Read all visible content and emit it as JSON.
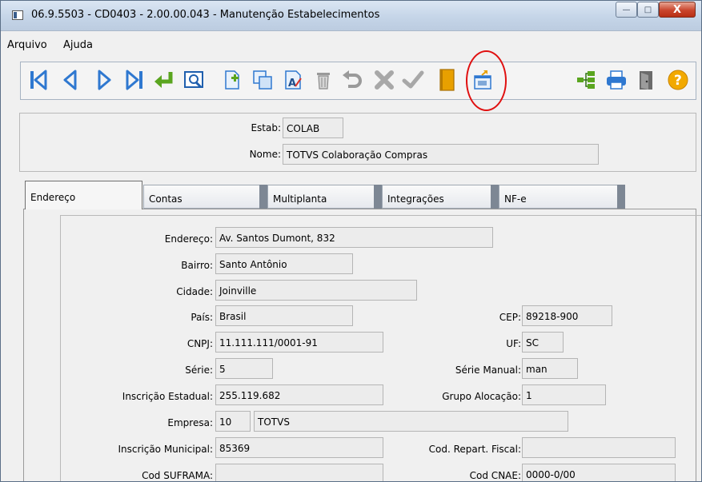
{
  "window": {
    "title": "06.9.5503 - CD0403 - 2.00.00.043 - Manutenção Estabelecimentos",
    "minimize_label": "—",
    "maximize_label": "□",
    "close_label": "X"
  },
  "menu": {
    "items": [
      "Arquivo",
      "Ajuda"
    ]
  },
  "toolbar": {
    "buttons": [
      "first-record",
      "previous-record",
      "next-record",
      "last-record",
      "go-to-record",
      "search-record",
      "new-record",
      "copy-record",
      "edit-record",
      "delete-record",
      "undo",
      "cancel",
      "confirm",
      "book",
      "export-settings",
      "tree-view",
      "print",
      "exit",
      "help"
    ],
    "colors": {
      "nav_blue": "#2f78d0",
      "green": "#5aa51f",
      "orange": "#e8a000",
      "gray": "#9a9a9a"
    }
  },
  "header": {
    "estab_label": "Estab:",
    "estab_value": "COLAB",
    "nome_label": "Nome:",
    "nome_value": "TOTVS Colaboração Compras"
  },
  "tabs": [
    "Endereço",
    "Contas",
    "Multiplanta",
    "Integrações",
    "NF-e"
  ],
  "form": {
    "endereco_label": "Endereço:",
    "endereco_value": "Av. Santos Dumont, 832",
    "bairro_label": "Bairro:",
    "bairro_value": "Santo Antônio",
    "cidade_label": "Cidade:",
    "cidade_value": "Joinville",
    "pais_label": "País:",
    "pais_value": "Brasil",
    "cep_label": "CEP:",
    "cep_value": "89218-900",
    "cnpj_label": "CNPJ:",
    "cnpj_value": "11.111.111/0001-91",
    "uf_label": "UF:",
    "uf_value": "SC",
    "serie_label": "Série:",
    "serie_value": "5",
    "serie_manual_label": "Série Manual:",
    "serie_manual_value": "man",
    "inscricao_estadual_label": "Inscrição Estadual:",
    "inscricao_estadual_value": "255.119.682",
    "grupo_alocacao_label": "Grupo Alocação:",
    "grupo_alocacao_value": "1",
    "empresa_label": "Empresa:",
    "empresa_code": "10",
    "empresa_name": "TOTVS",
    "inscricao_municipal_label": "Inscrição Municipal:",
    "inscricao_municipal_value": "85369",
    "cod_repart_fiscal_label": "Cod. Repart. Fiscal:",
    "cod_repart_fiscal_value": "",
    "cod_suframa_label": "Cod SUFRAMA:",
    "cod_suframa_value": "",
    "cod_cnae_label": "Cod CNAE:",
    "cod_cnae_value": "0000-0/00"
  }
}
